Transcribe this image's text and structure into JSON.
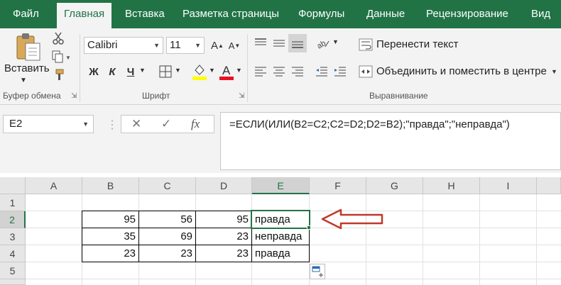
{
  "tabs": [
    "Файл",
    "Главная",
    "Вставка",
    "Разметка страницы",
    "Формулы",
    "Данные",
    "Рецензирование",
    "Вид"
  ],
  "ribbon": {
    "clipboard": {
      "paste_label": "Вставить",
      "group_label": "Буфер обмена"
    },
    "font": {
      "name": "Calibri",
      "size": "11",
      "bold": "Ж",
      "italic": "К",
      "underline": "Ч",
      "group_label": "Шрифт"
    },
    "alignment": {
      "wrap_text": "Перенести текст",
      "merge_center": "Объединить и поместить в центре",
      "group_label": "Выравнивание"
    }
  },
  "formula_bar": {
    "name_box": "E2",
    "fx": "fx",
    "formula": "=ЕСЛИ(ИЛИ(B2=C2;C2=D2;D2=B2);\"правда\";\"неправда\")"
  },
  "sheet": {
    "columns": [
      "A",
      "B",
      "C",
      "D",
      "E",
      "F",
      "G",
      "H",
      "I"
    ],
    "rows": [
      "1",
      "2",
      "3",
      "4",
      "5"
    ],
    "data": [
      {
        "b": "95",
        "c": "56",
        "d": "95",
        "e": "правда"
      },
      {
        "b": "35",
        "c": "69",
        "d": "23",
        "e": "неправда"
      },
      {
        "b": "23",
        "c": "23",
        "d": "23",
        "e": "правда"
      }
    ],
    "active_cell": "E2"
  },
  "colors": {
    "accent": "#217346",
    "arrow": "#c0392b",
    "fill_yellow": "#ffff00",
    "font_red": "#e81123"
  }
}
